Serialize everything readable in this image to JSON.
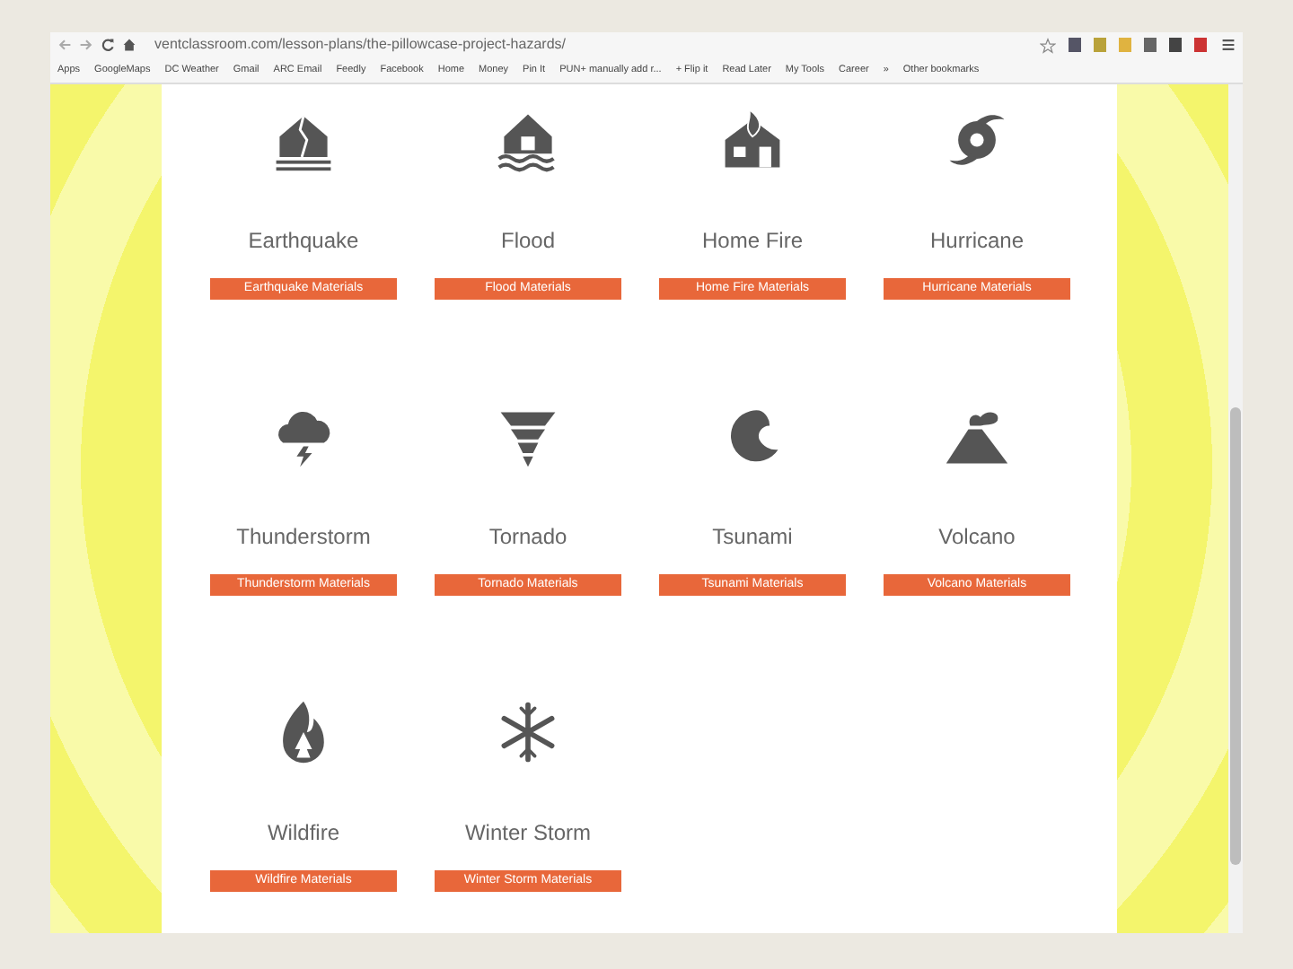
{
  "browser": {
    "url": "ventclassroom.com/lesson-plans/the-pillowcase-project-hazards/",
    "bookmarks": [
      "Apps",
      "GoogleMaps",
      "DC Weather",
      "Gmail",
      "ARC Email",
      "Feedly",
      "Facebook",
      "Home",
      "Money",
      "Pin It",
      "PUN+ manually add r...",
      "+ Flip it",
      "Read Later",
      "My Tools",
      "Career",
      "»",
      "Other bookmarks"
    ]
  },
  "hazards": [
    {
      "name": "Earthquake",
      "button": "Earthquake Materials"
    },
    {
      "name": "Flood",
      "button": "Flood Materials"
    },
    {
      "name": "Home Fire",
      "button": "Home Fire Materials"
    },
    {
      "name": "Hurricane",
      "button": "Hurricane Materials"
    },
    {
      "name": "Thunderstorm",
      "button": "Thunderstorm Materials"
    },
    {
      "name": "Tornado",
      "button": "Tornado Materials"
    },
    {
      "name": "Tsunami",
      "button": "Tsunami Materials"
    },
    {
      "name": "Volcano",
      "button": "Volcano Materials"
    },
    {
      "name": "Wildfire",
      "button": "Wildfire Materials"
    },
    {
      "name": "Winter Storm",
      "button": "Winter Storm Materials"
    }
  ]
}
